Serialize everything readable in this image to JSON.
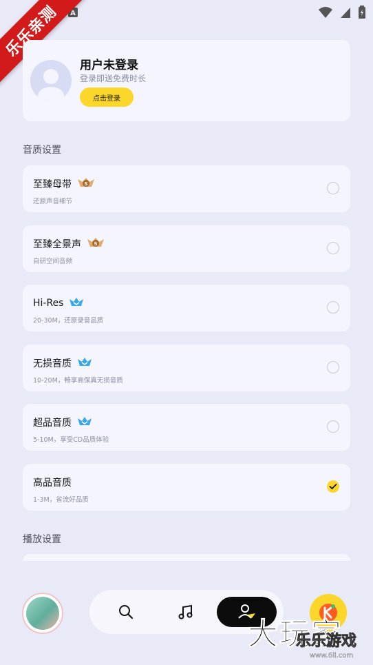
{
  "ribbon": {
    "text": "乐乐亲测"
  },
  "profile": {
    "title": "用户未登录",
    "subtitle": "登录即送免费时长",
    "login_button": "点击登录"
  },
  "quality_section": {
    "title": "音质设置",
    "options": [
      {
        "title": "至臻母带",
        "desc": "还原声音细节",
        "badge": "svip-icon",
        "badge_text": "S",
        "checked": false
      },
      {
        "title": "至臻全景声",
        "desc": "自研空间音频",
        "badge": "svip-icon",
        "badge_text": "S",
        "checked": false
      },
      {
        "title": "Hi-Res",
        "desc": "20-30M，还原录音品质",
        "badge": "vip-icon",
        "checked": false
      },
      {
        "title": "无损音质",
        "desc": "10-20M，畅享高保真无损音质",
        "badge": "vip-icon",
        "checked": false
      },
      {
        "title": "超品音质",
        "desc": "5-10M，享受CD品质体验",
        "badge": "vip-icon",
        "checked": false
      },
      {
        "title": "高品音质",
        "desc": "1-3M，省流好品质",
        "badge": "",
        "checked": true
      }
    ]
  },
  "playback_section": {
    "title": "播放设置"
  },
  "nav": {
    "items": [
      {
        "name": "search-icon"
      },
      {
        "name": "music-note-icon"
      },
      {
        "name": "profile-icon",
        "active": true
      }
    ]
  },
  "watermark": {
    "main": "大玩家",
    "sub": "乐乐游戏",
    "url": "www.6ll.com"
  },
  "colors": {
    "accent": "#fbd72b",
    "card": "#f4f5fe",
    "background": "#e9eaf7"
  }
}
